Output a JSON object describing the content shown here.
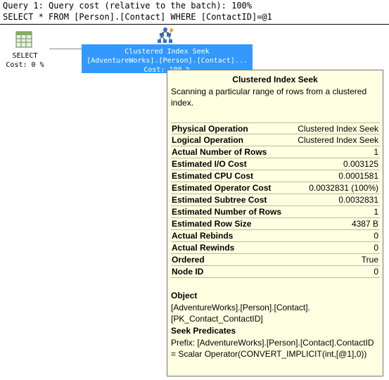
{
  "query": {
    "cost_line": "Query 1: Query cost (relative to the batch): 100%",
    "sql_line": "SELECT * FROM [Person].[Contact] WHERE [ContactID]=@1"
  },
  "nodes": {
    "select": {
      "icon": "select-operator-icon",
      "label": "SELECT",
      "cost": "Cost: 0 %"
    },
    "seek": {
      "icon": "clustered-index-seek-icon",
      "line1": "Clustered Index Seek",
      "line2": "[AdventureWorks].[Person].[Contact]...",
      "line3": "Cost: 100 %",
      "highlight_color": "#3399ff"
    }
  },
  "tooltip": {
    "title": "Clustered Index Seek",
    "description": "Scanning a particular range of rows from a clustered index.",
    "properties": [
      {
        "key": "Physical Operation",
        "value": "Clustered Index Seek"
      },
      {
        "key": "Logical Operation",
        "value": "Clustered Index Seek"
      },
      {
        "key": "Actual Number of Rows",
        "value": "1"
      },
      {
        "key": "Estimated I/O Cost",
        "value": "0.003125"
      },
      {
        "key": "Estimated CPU Cost",
        "value": "0.0001581"
      },
      {
        "key": "Estimated Operator Cost",
        "value": "0.0032831 (100%)"
      },
      {
        "key": "Estimated Subtree Cost",
        "value": "0.0032831"
      },
      {
        "key": "Estimated Number of Rows",
        "value": "1"
      },
      {
        "key": "Estimated Row Size",
        "value": "4387 B"
      },
      {
        "key": "Actual Rebinds",
        "value": "0"
      },
      {
        "key": "Actual Rewinds",
        "value": "0"
      },
      {
        "key": "Ordered",
        "value": "True"
      },
      {
        "key": "Node ID",
        "value": "0"
      }
    ],
    "object_heading": "Object",
    "object_line1": "[AdventureWorks].[Person].[Contact].",
    "object_line2": "[PK_Contact_ContactID]",
    "seek_heading": "Seek Predicates",
    "seek_line1": "Prefix: [AdventureWorks].[Person].[Contact].ContactID",
    "seek_line2": "= Scalar Operator(CONVERT_IMPLICIT(int,[@1],0))",
    "background": "#ffffe1"
  }
}
